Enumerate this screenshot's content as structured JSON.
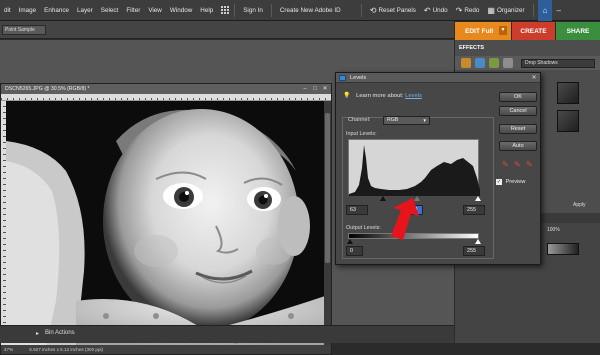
{
  "menubar": {
    "items": [
      "dit",
      "Image",
      "Enhance",
      "Layer",
      "Select",
      "Filter",
      "View",
      "Window",
      "Help"
    ],
    "sign_in": "Sign In",
    "create_id": "Create New Adobe ID",
    "reset_panels": "Reset Panels",
    "undo": "Undo",
    "redo": "Redo",
    "organizer": "Organizer"
  },
  "options": {
    "select_value": "Point Sample"
  },
  "tabs": {
    "edit": "EDIT Full",
    "create": "CREATE",
    "share": "SHARE"
  },
  "document": {
    "title": "DSCN5265.JPG @ 30.5% (RGB/8) *",
    "zoom": "47%",
    "info": "6.927 inches x 5.12 inches (300 ppi)"
  },
  "project_bin": {
    "label": "Bin Actions"
  },
  "effects": {
    "header": "EFFECTS",
    "dropdown": "Drop Shadows",
    "apply": "Apply"
  },
  "layers": {
    "opacity": "100%"
  },
  "levels": {
    "title": "Levels",
    "learn_more": "Learn more about:",
    "learn_link": "Levels",
    "ok": "OK",
    "cancel": "Cancel",
    "reset": "Reset",
    "auto": "Auto",
    "channel_label": "Channel:",
    "channel_value": "RGB",
    "input_label": "Input Levels:",
    "input_black": "63",
    "input_gray": "1.4",
    "input_white": "255",
    "output_label": "Output Levels:",
    "output_black": "0",
    "output_white": "255",
    "preview": "Preview",
    "preview_checked": true
  },
  "colors": {
    "edit_tab": "#e8891d",
    "create_tab": "#cc3d2b",
    "share_tab": "#3a8e3e",
    "annotation_arrow": "#e8141b"
  }
}
